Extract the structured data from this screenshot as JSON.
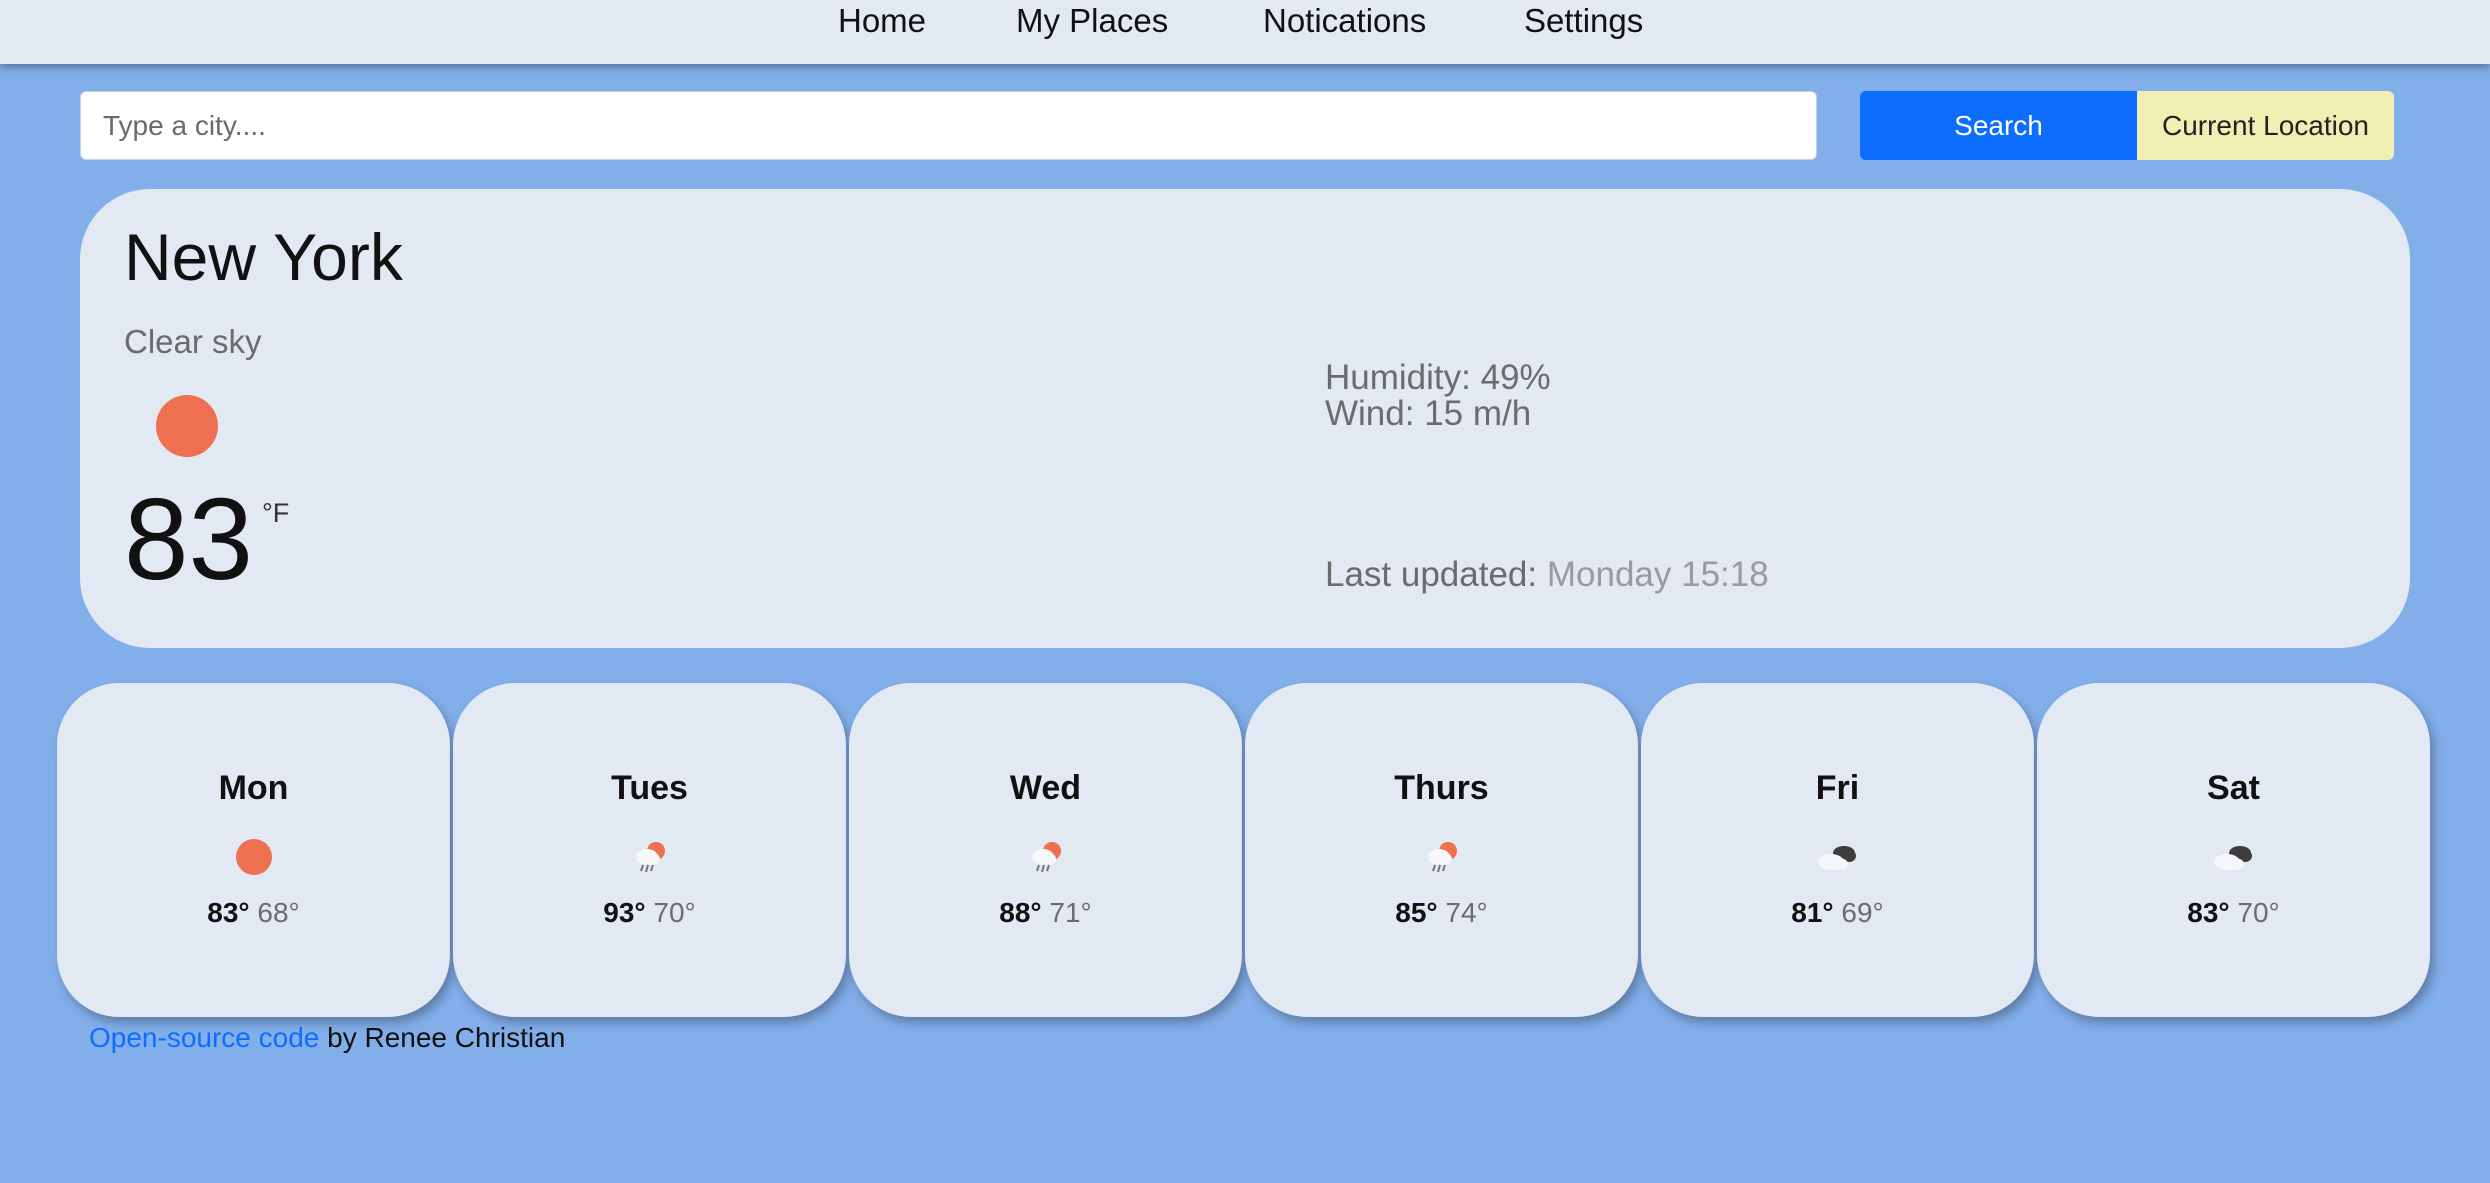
{
  "nav": {
    "items": [
      {
        "label": "Home"
      },
      {
        "label": "My Places"
      },
      {
        "label": "Notications"
      },
      {
        "label": "Settings"
      }
    ]
  },
  "search": {
    "placeholder": "Type a city....",
    "value": "",
    "search_label": "Search",
    "location_label": "Current Location"
  },
  "current": {
    "city": "New York",
    "description": "Clear sky",
    "icon": "sun-icon",
    "temperature": "83",
    "unit": "°F",
    "humidity": "Humidity: 49%",
    "wind": "Wind: 15 m/h",
    "updated_label": "Last updated:",
    "updated_time": "Monday 15:18"
  },
  "forecast": [
    {
      "day": "Mon",
      "icon": "sun-icon",
      "max": "83°",
      "min": "68°"
    },
    {
      "day": "Tues",
      "icon": "rain-sun-icon",
      "max": "93°",
      "min": "70°"
    },
    {
      "day": "Wed",
      "icon": "rain-sun-icon",
      "max": "88°",
      "min": "71°"
    },
    {
      "day": "Thurs",
      "icon": "rain-sun-icon",
      "max": "85°",
      "min": "74°"
    },
    {
      "day": "Fri",
      "icon": "broken-clouds-icon",
      "max": "81°",
      "min": "69°"
    },
    {
      "day": "Sat",
      "icon": "broken-clouds-icon",
      "max": "83°",
      "min": "70°"
    }
  ],
  "footer": {
    "link_text": "Open-source code",
    "byline": "by Renee Christian"
  },
  "colors": {
    "background": "#82aeea",
    "card": "#e2e9f3",
    "sun": "#ee7050",
    "search_button": "#0d6efd",
    "location_button": "#f0eeb2"
  }
}
